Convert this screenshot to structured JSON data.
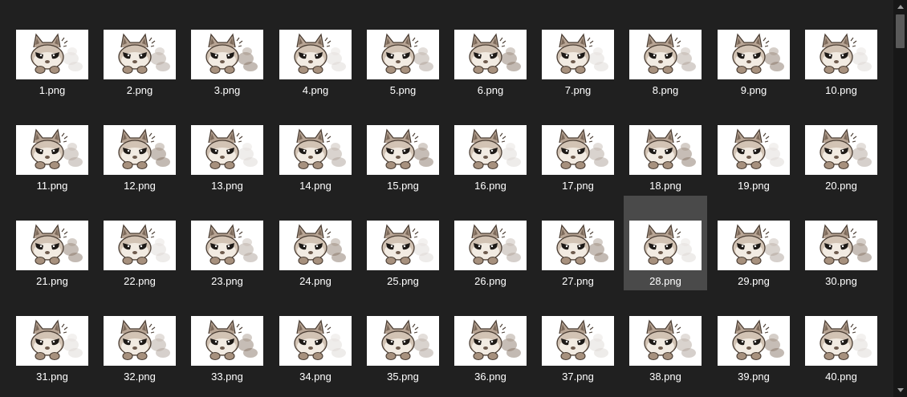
{
  "files": [
    {
      "name": "1.png"
    },
    {
      "name": "2.png"
    },
    {
      "name": "3.png"
    },
    {
      "name": "4.png"
    },
    {
      "name": "5.png"
    },
    {
      "name": "6.png"
    },
    {
      "name": "7.png"
    },
    {
      "name": "8.png"
    },
    {
      "name": "9.png"
    },
    {
      "name": "10.png"
    },
    {
      "name": "11.png"
    },
    {
      "name": "12.png"
    },
    {
      "name": "13.png"
    },
    {
      "name": "14.png"
    },
    {
      "name": "15.png"
    },
    {
      "name": "16.png"
    },
    {
      "name": "17.png"
    },
    {
      "name": "18.png"
    },
    {
      "name": "19.png"
    },
    {
      "name": "20.png"
    },
    {
      "name": "21.png"
    },
    {
      "name": "22.png"
    },
    {
      "name": "23.png"
    },
    {
      "name": "24.png"
    },
    {
      "name": "25.png"
    },
    {
      "name": "26.png"
    },
    {
      "name": "27.png"
    },
    {
      "name": "28.png",
      "selected": true
    },
    {
      "name": "29.png"
    },
    {
      "name": "30.png"
    },
    {
      "name": "31.png"
    },
    {
      "name": "32.png"
    },
    {
      "name": "33.png"
    },
    {
      "name": "34.png"
    },
    {
      "name": "35.png"
    },
    {
      "name": "36.png"
    },
    {
      "name": "37.png"
    },
    {
      "name": "38.png"
    },
    {
      "name": "39.png"
    },
    {
      "name": "40.png"
    }
  ],
  "thumbnail_icon": "cat-sticker-icon",
  "colors": {
    "background": "#202020",
    "selection": "#4a4a4a",
    "filename_text": "#ffffff",
    "scrollbar_track": "#171717",
    "scrollbar_thumb": "#5a5a5a"
  }
}
